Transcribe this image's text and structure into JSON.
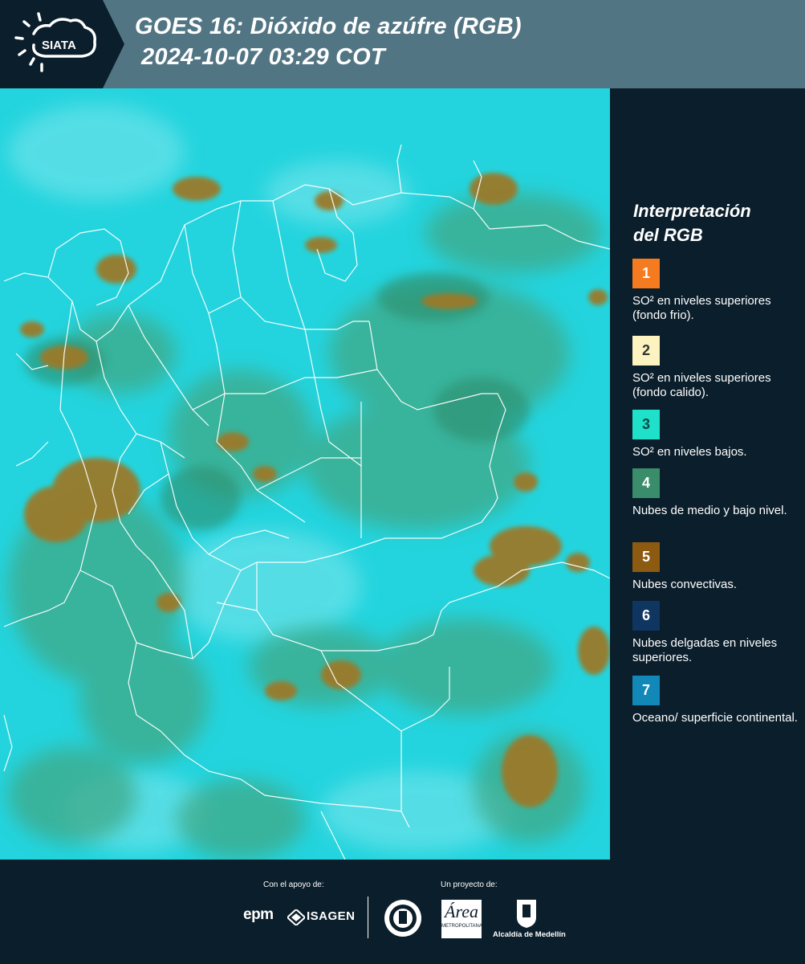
{
  "header": {
    "logo_text": "SIATA",
    "title_line1": "GOES 16: Dióxido de azúfre (RGB)",
    "title_line2": "2024-10-07 03:29 COT"
  },
  "legend": {
    "title_line1": "Interpretación",
    "title_line2": "del RGB",
    "items": [
      {
        "number": "1",
        "label": "SO² en niveles superiores (fondo frio).",
        "color": "#f47b20"
      },
      {
        "number": "2",
        "label": "SO² en niveles superiores (fondo calido).",
        "color": "#fdf3c0"
      },
      {
        "number": "3",
        "label": "SO² en niveles bajos.",
        "color": "#1fe0c8"
      },
      {
        "number": "4",
        "label": "Nubes de medio y bajo nivel.",
        "color": "#3a8d6a"
      },
      {
        "number": "5",
        "label": "Nubes convectivas.",
        "color": "#8d5a12"
      },
      {
        "number": "6",
        "label": "Nubes delgadas en niveles superiores.",
        "color": "#0f3561"
      },
      {
        "number": "7",
        "label": "Oceano/ superficie continental.",
        "color": "#1188b7"
      }
    ]
  },
  "footer": {
    "support_label": "Con el apoyo de:",
    "project_label": "Un proyecto de:",
    "epm": "epm",
    "isagen": "ISAGEN",
    "area_text": "Área",
    "area_sub": "METROPOLITANA",
    "alcaldia": "Alcaldía de Medellín"
  }
}
